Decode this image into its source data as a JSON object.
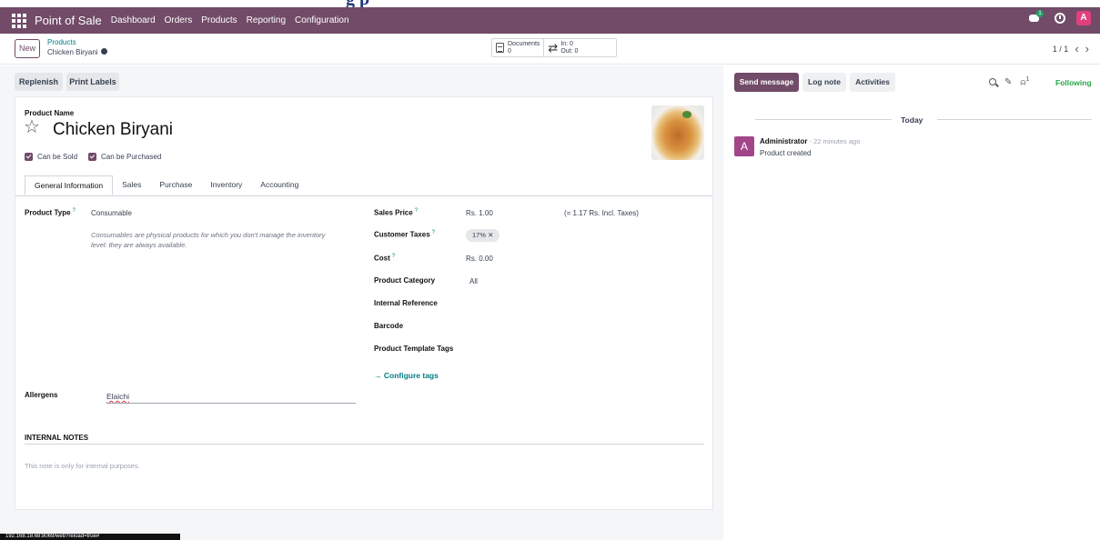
{
  "navbar": {
    "brand": "Point of Sale",
    "menus": [
      "Dashboard",
      "Orders",
      "Products",
      "Reporting",
      "Configuration"
    ],
    "chat_badge": "1",
    "avatar_letter": "A",
    "accent_color": "#714B67"
  },
  "control": {
    "new_label": "New",
    "breadcrumb_parent": "Products",
    "breadcrumb_current": "Chicken Biryani",
    "documents_label": "Documents",
    "documents_count": "0",
    "in_label": "In: 0",
    "out_label": "Out: 0",
    "pager": "1 / 1"
  },
  "actions": {
    "replenish": "Replenish",
    "print_labels": "Print Labels"
  },
  "form": {
    "product_name_label": "Product Name",
    "product_name": "Chicken Biryani",
    "can_be_sold": "Can be Sold",
    "can_be_purchased": "Can be Purchased",
    "tabs": [
      "General Information",
      "Sales",
      "Purchase",
      "Inventory",
      "Accounting"
    ],
    "active_tab": "General Information",
    "product_type_label": "Product Type",
    "product_type": "Consumable",
    "product_type_note": "Consumables are physical products for which you don't manage the inventory level: they are always available.",
    "sales_price_label": "Sales Price",
    "sales_price": "Rs. 1.00",
    "sales_price_incl": "(= 1.17 Rs. Incl. Taxes)",
    "customer_taxes_label": "Customer Taxes",
    "customer_tax": "17% ✕",
    "cost_label": "Cost",
    "cost": "Rs. 0.00",
    "category_label": "Product Category",
    "category": "All",
    "internal_ref_label": "Internal Reference",
    "barcode_label": "Barcode",
    "tags_label": "Product Template Tags",
    "configure_tags": "→ Configure tags",
    "allergens_label": "Allergens",
    "allergens": "Elaichi",
    "internal_notes_title": "INTERNAL NOTES",
    "internal_notes_placeholder": "This note is only for internal purposes."
  },
  "chatter": {
    "send_message": "Send message",
    "log_note": "Log note",
    "activities": "Activities",
    "followers_count": "1",
    "following": "Following",
    "today": "Today",
    "message": {
      "avatar": "A",
      "author": "Administrator",
      "time": " - 22 minutes ago",
      "body": "Product created"
    }
  },
  "status_url": "192.168.18.68:8069/web?reload=true#"
}
